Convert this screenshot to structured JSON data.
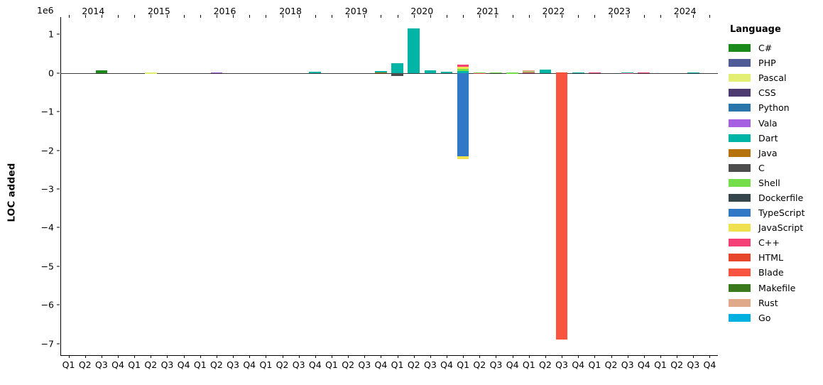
{
  "chart": {
    "type": "bar",
    "title": "",
    "xlabel": "",
    "ylabel": "LOC added",
    "offset_text": "1e6",
    "ylim": [
      -7300000,
      1450000
    ],
    "yticks": [
      1000000,
      0,
      -1000000,
      -2000000,
      -3000000,
      -4000000,
      -5000000,
      -6000000,
      -7000000
    ],
    "ytick_labels": [
      "1",
      "0",
      "−1",
      "−2",
      "−3",
      "−4",
      "−5",
      "−6",
      "−7"
    ],
    "grid": false,
    "stacked": true,
    "legend_title": "Language",
    "legend_position": "right"
  },
  "legend": {
    "title": "Language",
    "items": [
      {
        "label": "C#",
        "color": "#1a8a1a"
      },
      {
        "label": "PHP",
        "color": "#4f5b96"
      },
      {
        "label": "Pascal",
        "color": "#e2ef72"
      },
      {
        "label": "CSS",
        "color": "#4c3a70"
      },
      {
        "label": "Python",
        "color": "#2a76ac"
      },
      {
        "label": "Vala",
        "color": "#a濾"
      },
      {
        "label": "Dart",
        "color": "#00b4a6"
      },
      {
        "label": "Java",
        "color": "#b5720d"
      },
      {
        "label": "C",
        "color": "#4d4d4d"
      },
      {
        "label": "Shell",
        "color": "#73dd4a"
      },
      {
        "label": "Dockerfile",
        "color": "#35454c"
      },
      {
        "label": "TypeScript",
        "color": "#3178c6"
      },
      {
        "label": "JavaScript",
        "color": "#f0e14e"
      },
      {
        "label": "C++",
        "color": "#f43f77"
      },
      {
        "label": "HTML",
        "color": "#e8462b"
      },
      {
        "label": "Blade",
        "color": "#f9543f"
      },
      {
        "label": "Makefile",
        "color": "#3a7a1c"
      },
      {
        "label": "Rust",
        "color": "#e0a98a"
      },
      {
        "label": "Go",
        "color": "#00b0e0"
      }
    ]
  },
  "axes": {
    "years": [
      "2014",
      "2015",
      "2016",
      "2018",
      "2019",
      "2020",
      "2021",
      "2022",
      "2023",
      "2024"
    ],
    "quarters": [
      "Q1",
      "Q2",
      "Q3",
      "Q4"
    ]
  },
  "chart_data": {
    "type": "bar",
    "stacked": true,
    "title": "",
    "xlabel": "",
    "ylabel": "LOC added",
    "offset": "1e6",
    "ylim": [
      -7300000,
      1450000
    ],
    "yticks": [
      1000000,
      0,
      -1000000,
      -2000000,
      -3000000,
      -4000000,
      -5000000,
      -6000000,
      -7000000
    ],
    "categories": [
      "2014 Q1",
      "2014 Q2",
      "2014 Q3",
      "2014 Q4",
      "2015 Q1",
      "2015 Q2",
      "2015 Q3",
      "2015 Q4",
      "2016 Q1",
      "2016 Q2",
      "2016 Q3",
      "2016 Q4",
      "2018 Q1",
      "2018 Q2",
      "2018 Q3",
      "2018 Q4",
      "2019 Q1",
      "2019 Q2",
      "2019 Q3",
      "2019 Q4",
      "2020 Q1",
      "2020 Q2",
      "2020 Q3",
      "2020 Q4",
      "2021 Q1",
      "2021 Q2",
      "2021 Q3",
      "2021 Q4",
      "2022 Q1",
      "2022 Q2",
      "2022 Q3",
      "2022 Q4",
      "2023 Q1",
      "2023 Q2",
      "2023 Q3",
      "2023 Q4",
      "2024 Q1",
      "2024 Q2",
      "2024 Q3",
      "2024 Q4"
    ],
    "bars": [
      {
        "cat": "2014 Q3",
        "segments": [
          {
            "lang": "C#",
            "value": 78000
          }
        ]
      },
      {
        "cat": "2015 Q2",
        "segments": [
          {
            "lang": "Pascal",
            "value": 16000
          }
        ]
      },
      {
        "cat": "2016 Q2",
        "segments": [
          {
            "lang": "Vala",
            "value": 18000
          }
        ]
      },
      {
        "cat": "2018 Q4",
        "segments": [
          {
            "lang": "Dart",
            "value": 36000
          }
        ]
      },
      {
        "cat": "2019 Q4",
        "segments": [
          {
            "lang": "Java",
            "value": 34000
          },
          {
            "lang": "Dart",
            "value": 14000
          }
        ]
      },
      {
        "cat": "2020 Q1",
        "segments": [
          {
            "lang": "Dart",
            "value": 250000
          },
          {
            "lang": "C",
            "value": -72000
          }
        ]
      },
      {
        "cat": "2020 Q2",
        "segments": [
          {
            "lang": "Dart",
            "value": 1150000
          }
        ]
      },
      {
        "cat": "2020 Q3",
        "segments": [
          {
            "lang": "Dart",
            "value": 72000
          },
          {
            "lang": "Dockerfile",
            "value": -10000
          }
        ]
      },
      {
        "cat": "2020 Q4",
        "segments": [
          {
            "lang": "Dart",
            "value": 40000
          }
        ]
      },
      {
        "cat": "2021 Q1",
        "segments": [
          {
            "lang": "Dart",
            "value": 60000
          },
          {
            "lang": "Shell",
            "value": 55000
          },
          {
            "lang": "JavaScript",
            "value": 52000
          },
          {
            "lang": "C++",
            "value": 58000
          },
          {
            "lang": "TypeScript",
            "value": -2150000
          },
          {
            "lang": "JavaScript",
            "value": -70000
          }
        ]
      },
      {
        "cat": "2021 Q2",
        "segments": [
          {
            "lang": "C++",
            "value": 12000
          },
          {
            "lang": "Shell",
            "value": 10000
          }
        ]
      },
      {
        "cat": "2021 Q3",
        "segments": [
          {
            "lang": "Shell",
            "value": 20000
          }
        ]
      },
      {
        "cat": "2021 Q4",
        "segments": [
          {
            "lang": "Shell",
            "value": 16000
          }
        ]
      },
      {
        "cat": "2022 Q1",
        "segments": [
          {
            "lang": "C++",
            "value": 30000
          },
          {
            "lang": "Shell",
            "value": 24000
          },
          {
            "lang": "Rust",
            "value": 10000
          }
        ]
      },
      {
        "cat": "2022 Q2",
        "segments": [
          {
            "lang": "Dart",
            "value": 82000
          }
        ]
      },
      {
        "cat": "2022 Q3",
        "segments": [
          {
            "lang": "HTML",
            "value": 22000
          },
          {
            "lang": "Blade",
            "value": -6900000
          }
        ]
      },
      {
        "cat": "2022 Q4",
        "segments": [
          {
            "lang": "Dart",
            "value": 22000
          }
        ]
      },
      {
        "cat": "2023 Q1",
        "segments": [
          {
            "lang": "C++",
            "value": 20000
          }
        ]
      },
      {
        "cat": "2023 Q3",
        "segments": [
          {
            "lang": "Dart",
            "value": 24000
          },
          {
            "lang": "C++",
            "value": -16000
          }
        ]
      },
      {
        "cat": "2023 Q4",
        "segments": [
          {
            "lang": "C++",
            "value": 20000
          }
        ]
      },
      {
        "cat": "2024 Q3",
        "segments": [
          {
            "lang": "Dart",
            "value": 22000
          }
        ]
      }
    ]
  }
}
